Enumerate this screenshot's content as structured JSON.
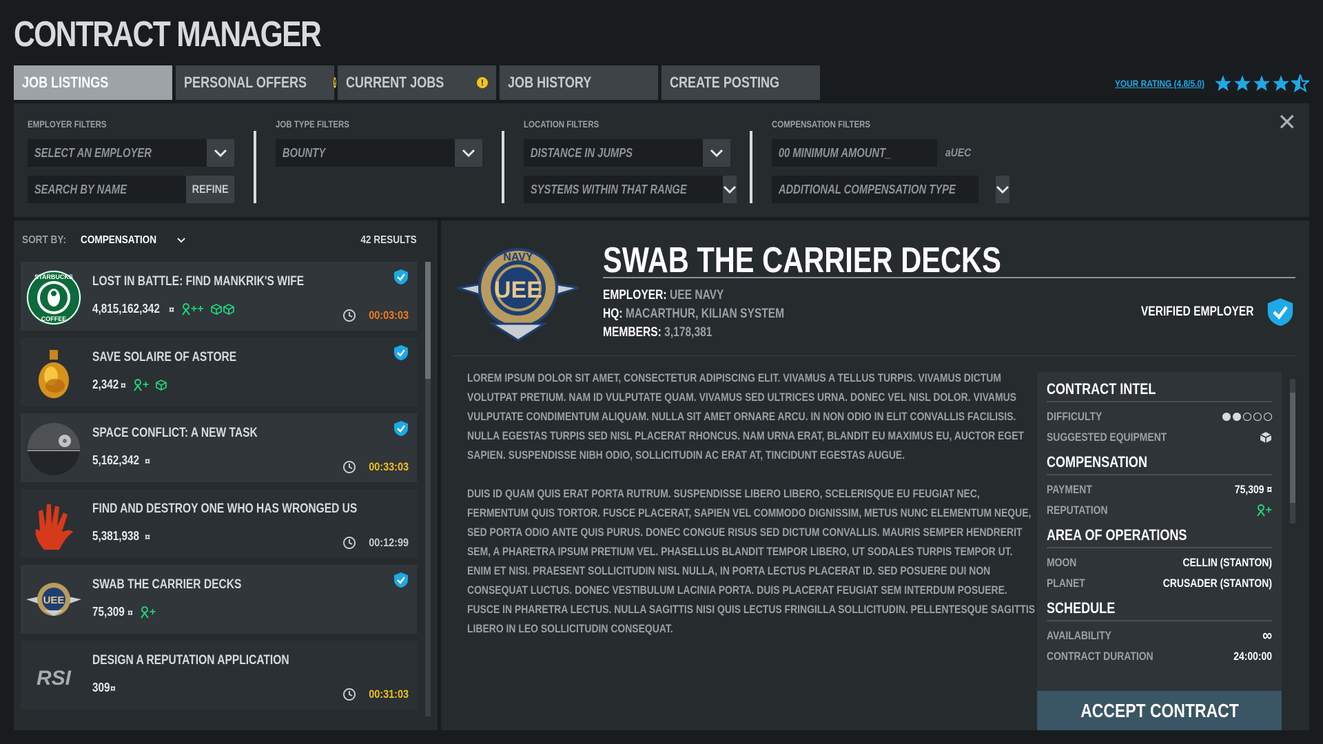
{
  "app": {
    "title": "CONTRACT MANAGER"
  },
  "tabs": [
    {
      "label": "JOB LISTINGS",
      "active": true,
      "alert": false
    },
    {
      "label": "PERSONAL OFFERS",
      "active": false,
      "alert": true
    },
    {
      "label": "CURRENT JOBS",
      "active": false,
      "alert": true
    },
    {
      "label": "JOB HISTORY",
      "active": false,
      "alert": false
    },
    {
      "label": "CREATE POSTING",
      "active": false,
      "alert": false
    }
  ],
  "rating": {
    "label": "YOUR RATING (4.8/5.0)",
    "value": 4.8,
    "max": 5,
    "color": "#1ea9e6"
  },
  "filters": {
    "employer": {
      "label": "EMPLOYER FILTERS",
      "select_placeholder": "SELECT AN EMPLOYER",
      "search_placeholder": "SEARCH BY NAME",
      "refine_label": "REFINE"
    },
    "job_type": {
      "label": "JOB TYPE FILTERS",
      "select_value": "BOUNTY"
    },
    "location": {
      "label": "LOCATION FILTERS",
      "distance_placeholder": "DISTANCE IN JUMPS",
      "systems_placeholder": "SYSTEMS WITHIN THAT RANGE"
    },
    "compensation": {
      "label": "COMPENSATION FILTERS",
      "amount_placeholder": "00 MINIMUM AMOUNT_",
      "currency_suffix": "aUEC",
      "type_placeholder": "ADDITIONAL COMPENSATION TYPE"
    }
  },
  "list": {
    "sort_label": "SORT BY:",
    "sort_value": "COMPENSATION",
    "results": "42 RESULTS",
    "items": [
      {
        "title": "LOST IN BATTLE: FIND MANKRIK'S WIFE",
        "amount": "4,815,162,342",
        "rep": "++",
        "crates": 2,
        "verified": true,
        "timer": "00:03:03",
        "timer_color": "#ef7b1a",
        "thumb": "starbucks-logo"
      },
      {
        "title": "SAVE SOLAIRE OF ASTORE",
        "amount": "2,342",
        "rep": "+",
        "crates": 1,
        "verified": true,
        "timer": "",
        "thumb": "estus-flask"
      },
      {
        "title": "SPACE CONFLICT: A NEW TASK",
        "amount": "5,162,342",
        "rep": "",
        "crates": 0,
        "verified": true,
        "timer": "00:33:03",
        "timer_color": "#f0c11a",
        "thumb": "death-star"
      },
      {
        "title": "FIND AND DESTROY ONE WHO HAS WRONGED US",
        "amount": "5,381,938",
        "rep": "",
        "crates": 0,
        "verified": false,
        "timer": "00:12:99",
        "timer_color": "#c8cbce",
        "thumb": "red-hand"
      },
      {
        "title": "SWAB THE CARRIER DECKS",
        "amount": "75,309",
        "rep": "+",
        "crates": 0,
        "verified": true,
        "timer": "",
        "thumb": "uee-navy-logo"
      },
      {
        "title": "DESIGN A REPUTATION APPLICATION",
        "amount": "309",
        "rep": "",
        "crates": 0,
        "verified": false,
        "timer": "00:31:03",
        "timer_color": "#f0c11a",
        "thumb": "rsi-logo"
      }
    ]
  },
  "detail": {
    "title": "SWAB THE CARRIER DECKS",
    "logo_text": "NAVY",
    "employer_label": "EMPLOYER:",
    "employer": "UEE NAVY",
    "hq_label": "HQ:",
    "hq": "MACARTHUR, KILIAN SYSTEM",
    "members_label": "MEMBERS:",
    "members": "3,178,381",
    "verified_label": "VERIFIED EMPLOYER",
    "description": [
      "LOREM IPSUM DOLOR SIT AMET, CONSECTETUR ADIPISCING ELIT. VIVAMUS A TELLUS TURPIS. VIVAMUS DICTUM VOLUTPAT PRETIUM. NAM ID VULPUTATE QUAM. VIVAMUS SED ULTRICES URNA. DONEC VEL NISL DOLOR. VIVAMUS VULPUTATE CONDIMENTUM ALIQUAM. NULLA SIT AMET ORNARE ARCU. IN NON ODIO IN ELIT CONVALLIS FACILISIS. NULLA EGESTAS TURPIS SED NISL PLACERAT RHONCUS. NAM URNA ERAT, BLANDIT EU MAXIMUS EU, AUCTOR EGET SAPIEN. SUSPENDISSE NIBH ODIO, SOLLICITUDIN AC ERAT AT, TINCIDUNT EGESTAS AUGUE.",
      "DUIS ID QUAM QUIS ERAT PORTA RUTRUM. SUSPENDISSE LIBERO LIBERO, SCELERISQUE EU FEUGIAT NEC, FERMENTUM QUIS TORTOR. FUSCE PLACERAT, SAPIEN VEL COMMODO DIGNISSIM, METUS NUNC ELEMENTUM NEQUE, SED PORTA ODIO ANTE QUIS PURUS. DONEC CONGUE RISUS SED DICTUM CONVALLIS. MAURIS SEMPER HENDRERIT SEM, A PHARETRA IPSUM PRETIUM VEL. PHASELLUS BLANDIT TEMPOR LIBERO, UT SODALES TURPIS TEMPOR UT. ENIM ET NISI. PRAESENT SOLLICITUDIN NISL NULLA, IN PORTA LECTUS PLACERAT ID. SED POSUERE DUI NON CONSEQUAT LUCTUS. DONEC VESTIBULUM LACINIA PORTA. DUIS PLACERAT FEUGIAT SEM INTERDUM POSUERE. FUSCE IN PHARETRA LECTUS. NULLA SAGITTIS NISI QUIS LECTUS FRINGILLA SOLLICITUDIN. PELLENTESQUE SAGITTIS LIBERO IN LEO SOLLICITUDIN CONSEQUAT."
    ],
    "intel": {
      "contract_h": "CONTRACT INTEL",
      "difficulty_label": "DIFFICULTY",
      "difficulty": 2,
      "difficulty_max": 5,
      "equipment_label": "SUGGESTED EQUIPMENT",
      "compensation_h": "COMPENSATION",
      "payment_label": "PAYMENT",
      "payment": "75,309",
      "reputation_label": "REPUTATION",
      "reputation": "+",
      "area_h": "AREA OF OPERATIONS",
      "moon_label": "MOON",
      "moon": "CELLIN (STANTON)",
      "planet_label": "PLANET",
      "planet": "CRUSADER (STANTON)",
      "schedule_h": "SCHEDULE",
      "availability_label": "AVAILABILITY",
      "availability": "∞",
      "duration_label": "CONTRACT DURATION",
      "duration": "24:00:00"
    },
    "accept_label": "ACCEPT CONTRACT"
  },
  "colors": {
    "accent": "#1ea9e6",
    "rep_green": "#20d37a",
    "alert": "#f3c31a"
  }
}
